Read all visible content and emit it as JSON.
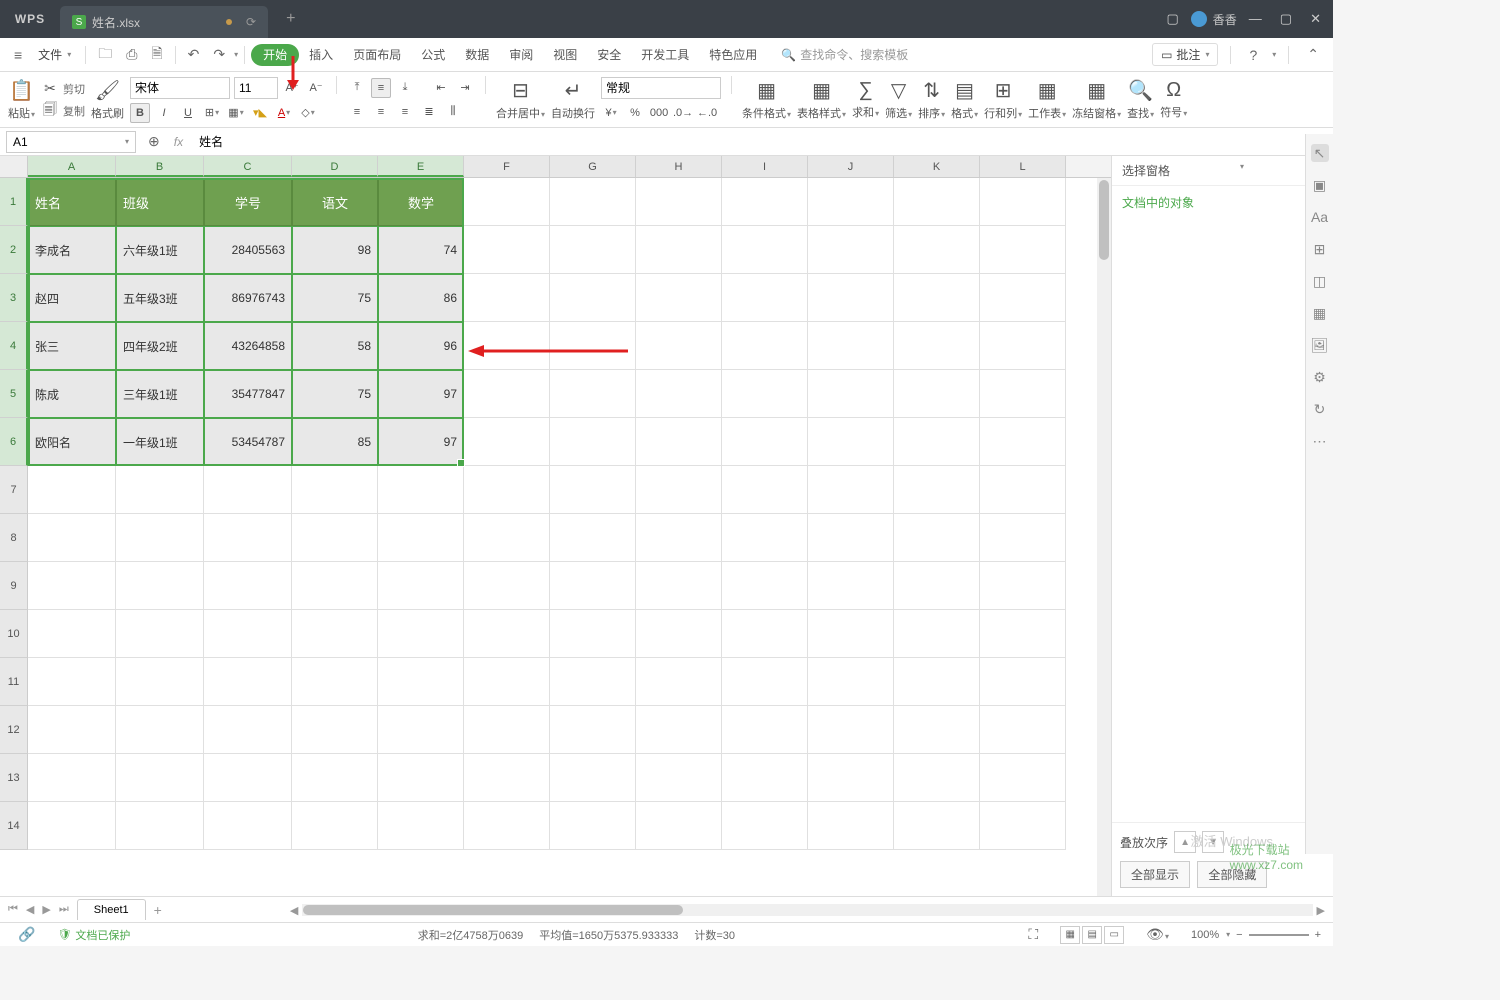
{
  "titlebar": {
    "logo": "WPS",
    "tab_name": "姓名.xlsx",
    "user": "香香"
  },
  "menubar": {
    "file": "文件",
    "tabs": [
      "开始",
      "插入",
      "页面布局",
      "公式",
      "数据",
      "审阅",
      "视图",
      "安全",
      "开发工具",
      "特色应用"
    ],
    "active": 0,
    "search_placeholder": "查找命令、搜索模板",
    "pizhu": "批注"
  },
  "toolbar": {
    "paste": "粘贴",
    "cut": "剪切",
    "copy": "复制",
    "format_painter": "格式刷",
    "font": "宋体",
    "size": "11",
    "merge_center": "合并居中",
    "auto_wrap": "自动换行",
    "number_format": "常规",
    "cond_format": "条件格式",
    "table_style": "表格样式",
    "sum": "求和",
    "filter": "筛选",
    "sort": "排序",
    "format2": "格式",
    "rowcol": "行和列",
    "worksheet": "工作表",
    "freeze": "冻结窗格",
    "find": "查找",
    "symbol": "符号"
  },
  "cellref": {
    "cell": "A1",
    "formula": "姓名"
  },
  "columns": [
    "A",
    "B",
    "C",
    "D",
    "E",
    "F",
    "G",
    "H",
    "I",
    "J",
    "K",
    "L"
  ],
  "selected_cols": 5,
  "selected_rows": 6,
  "table": {
    "headers": [
      "姓名",
      "班级",
      "学号",
      "语文",
      "数学"
    ],
    "rows": [
      {
        "name": "李成名",
        "class": "六年级1班",
        "id": "28405563",
        "chinese": "98",
        "math": "74"
      },
      {
        "name": "赵四",
        "class": "五年级3班",
        "id": "86976743",
        "chinese": "75",
        "math": "86"
      },
      {
        "name": "张三",
        "class": "四年级2班",
        "id": "43264858",
        "chinese": "58",
        "math": "96"
      },
      {
        "name": "陈成",
        "class": "三年级1班",
        "id": "35477847",
        "chinese": "75",
        "math": "97"
      },
      {
        "name": "欧阳名",
        "class": "一年级1班",
        "id": "53454787",
        "chinese": "85",
        "math": "97"
      }
    ]
  },
  "empty_rows": [
    7,
    8,
    9,
    10,
    11,
    12,
    13,
    14
  ],
  "panel": {
    "header": "选择窗格",
    "title": "文档中的对象",
    "stack": "叠放次序",
    "show_all": "全部显示",
    "hide_all": "全部隐藏"
  },
  "sheet": {
    "name": "Sheet1"
  },
  "status": {
    "protect": "文档已保护",
    "sum": "求和=2亿4758万0639",
    "avg": "平均值=1650万5375.933333",
    "count": "计数=30",
    "zoom": "100%"
  },
  "watermark": {
    "activate": "激活 Windows",
    "site1": "极光下载站",
    "site2": "www.xz7.com"
  }
}
